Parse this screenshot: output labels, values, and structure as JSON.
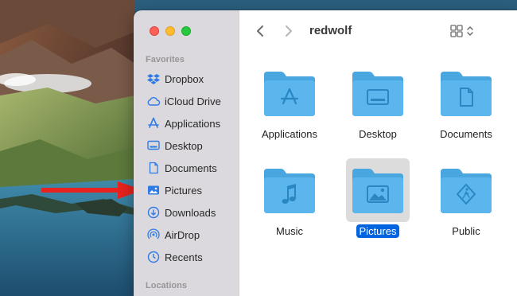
{
  "window": {
    "title": "redwolf"
  },
  "sidebar": {
    "favorites_title": "Favorites",
    "locations_title": "Locations",
    "items": [
      {
        "label": "Dropbox",
        "icon": "dropbox-icon"
      },
      {
        "label": "iCloud Drive",
        "icon": "cloud-icon"
      },
      {
        "label": "Applications",
        "icon": "applications-icon"
      },
      {
        "label": "Desktop",
        "icon": "desktop-icon"
      },
      {
        "label": "Documents",
        "icon": "document-icon"
      },
      {
        "label": "Pictures",
        "icon": "picture-icon"
      },
      {
        "label": "Downloads",
        "icon": "download-icon"
      },
      {
        "label": "AirDrop",
        "icon": "airdrop-icon"
      },
      {
        "label": "Recents",
        "icon": "clock-icon"
      }
    ]
  },
  "folders": [
    {
      "label": "Applications",
      "icon": "app-store-icon",
      "selected": false
    },
    {
      "label": "Desktop",
      "icon": "desktop-icon",
      "selected": false
    },
    {
      "label": "Documents",
      "icon": "document-icon",
      "selected": false
    },
    {
      "label": "Music",
      "icon": "music-note-icon",
      "selected": false
    },
    {
      "label": "Pictures",
      "icon": "picture-icon",
      "selected": true
    },
    {
      "label": "Public",
      "icon": "public-sign-icon",
      "selected": false
    }
  ],
  "colors": {
    "accent": "#0064e1",
    "folder": "#5ab6ec",
    "sidebar_icon": "#2f7be6",
    "arrow": "#e8221f"
  }
}
